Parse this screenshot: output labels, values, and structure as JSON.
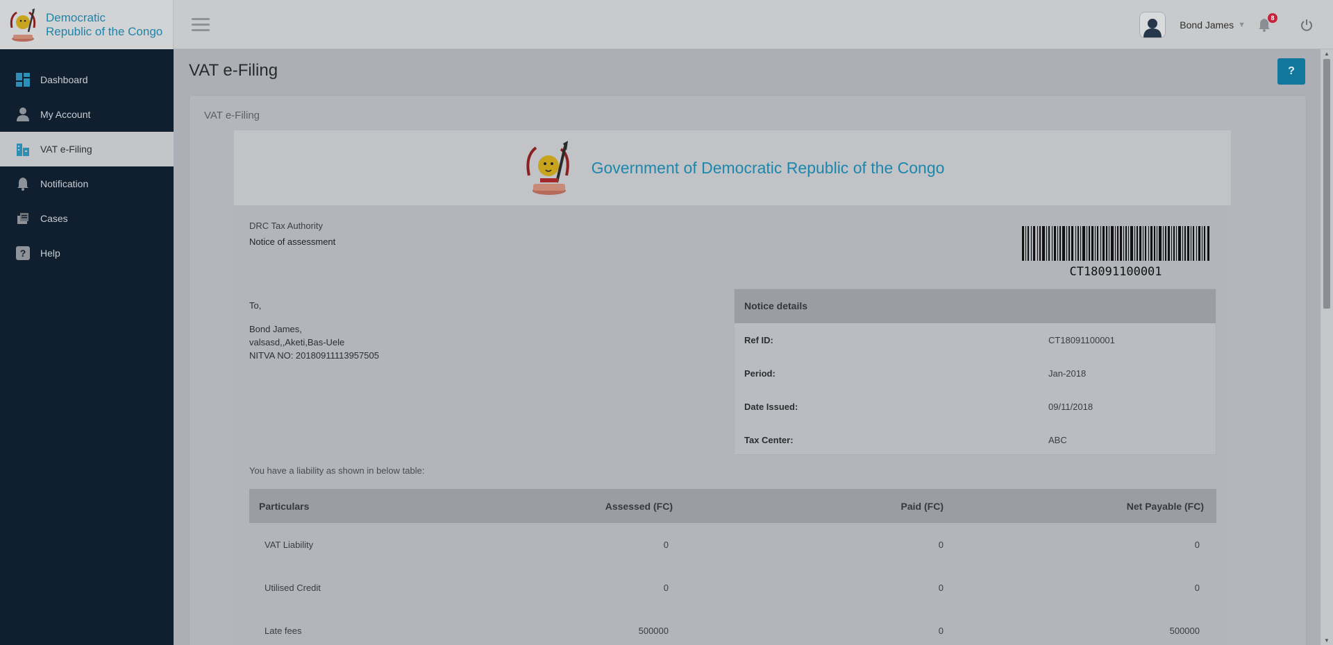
{
  "brand": {
    "line1": "Democratic",
    "line2": "Republic of the Congo"
  },
  "header": {
    "user_name": "Bond James",
    "notification_count": "8"
  },
  "sidebar": {
    "items": [
      {
        "label": "Dashboard",
        "icon": "dashboard-icon"
      },
      {
        "label": "My Account",
        "icon": "user-icon"
      },
      {
        "label": "VAT e-Filing",
        "icon": "building-icon"
      },
      {
        "label": "Notification",
        "icon": "bell-icon"
      },
      {
        "label": "Cases",
        "icon": "cases-icon"
      },
      {
        "label": "Help",
        "icon": "help-icon"
      }
    ]
  },
  "page": {
    "title": "VAT e-Filing",
    "help_label": "?",
    "panel_title": "VAT e-Filing"
  },
  "document": {
    "gov_title": "Government of Democratic Republic of the Congo",
    "authority": "DRC Tax Authority",
    "notice_label": "Notice of assessment",
    "barcode_text": "CT18091100001",
    "to": {
      "salutation": "To,",
      "name": "Bond James,",
      "address": "valsasd,,Aketi,Bas-Uele",
      "nitva": "NITVA NO: 20180911113957505"
    },
    "notice_details": {
      "title": "Notice details",
      "rows": [
        {
          "label": "Ref ID:",
          "value": "CT18091100001"
        },
        {
          "label": "Period:",
          "value": "Jan-2018"
        },
        {
          "label": "Date Issued:",
          "value": "09/11/2018"
        },
        {
          "label": "Tax Center:",
          "value": "ABC"
        }
      ]
    },
    "liability_text": "You have a liability as shown in below table:",
    "table": {
      "headers": [
        "Particulars",
        "Assessed (FC)",
        "Paid (FC)",
        "Net Payable (FC)"
      ],
      "rows": [
        [
          "VAT Liability",
          "0",
          "0",
          "0"
        ],
        [
          "Utilised Credit",
          "0",
          "0",
          "0"
        ],
        [
          "Late fees",
          "500000",
          "0",
          "500000"
        ]
      ]
    }
  },
  "colors": {
    "accent": "#1e84a9",
    "sidebar": "#0f1f2f",
    "badge": "#c6233a"
  }
}
